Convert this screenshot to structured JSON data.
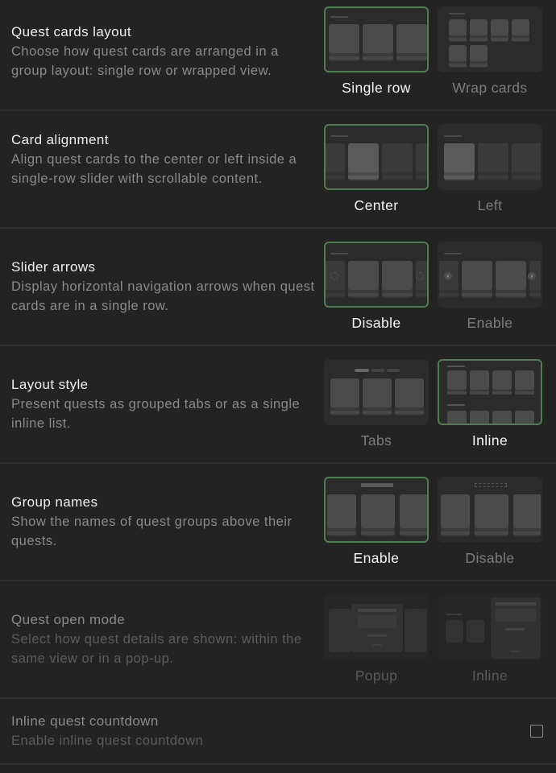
{
  "settings": [
    {
      "id": "quest-cards-layout",
      "title": "Quest cards layout",
      "description": "Choose how quest cards are arranged in a group layout: single row or wrapped view.",
      "options": [
        {
          "label": "Single row",
          "selected": true,
          "preview": "single-row"
        },
        {
          "label": "Wrap cards",
          "selected": false,
          "preview": "wrap"
        }
      ]
    },
    {
      "id": "card-alignment",
      "title": "Card alignment",
      "description": "Align quest cards to the center or left inside a single-row slider with scrollable content.",
      "options": [
        {
          "label": "Center",
          "selected": true,
          "preview": "center"
        },
        {
          "label": "Left",
          "selected": false,
          "preview": "left"
        }
      ]
    },
    {
      "id": "slider-arrows",
      "title": "Slider arrows",
      "description": "Display horizontal navigation arrows when quest cards are in a single row.",
      "options": [
        {
          "label": "Disable",
          "selected": true,
          "preview": "arrows-off"
        },
        {
          "label": "Enable",
          "selected": false,
          "preview": "arrows-on"
        }
      ]
    },
    {
      "id": "layout-style",
      "title": "Layout style",
      "description": "Present quests as grouped tabs or as a single inline list.",
      "options": [
        {
          "label": "Tabs",
          "selected": false,
          "preview": "tabs"
        },
        {
          "label": "Inline",
          "selected": true,
          "preview": "inline"
        }
      ]
    },
    {
      "id": "group-names",
      "title": "Group names",
      "description": "Show the names of quest groups above their quests.",
      "options": [
        {
          "label": "Enable",
          "selected": true,
          "preview": "names-on"
        },
        {
          "label": "Disable",
          "selected": false,
          "preview": "names-off"
        }
      ]
    },
    {
      "id": "quest-open-mode",
      "title": "Quest open mode",
      "description": "Select how quest details are shown: within the same view or in a pop-up.",
      "disabled": true,
      "options": [
        {
          "label": "Popup",
          "selected": false,
          "preview": "popup"
        },
        {
          "label": "Inline",
          "selected": false,
          "preview": "inline-detail"
        }
      ]
    }
  ],
  "countdown": {
    "title": "Inline quest countdown",
    "description": "Enable inline quest countdown",
    "checked": false,
    "disabled": true
  },
  "colors": {
    "background": "#232323",
    "selected_border": "#4e7f4e",
    "title_text": "#f0f0f0",
    "description_text": "#8a8a8a"
  }
}
